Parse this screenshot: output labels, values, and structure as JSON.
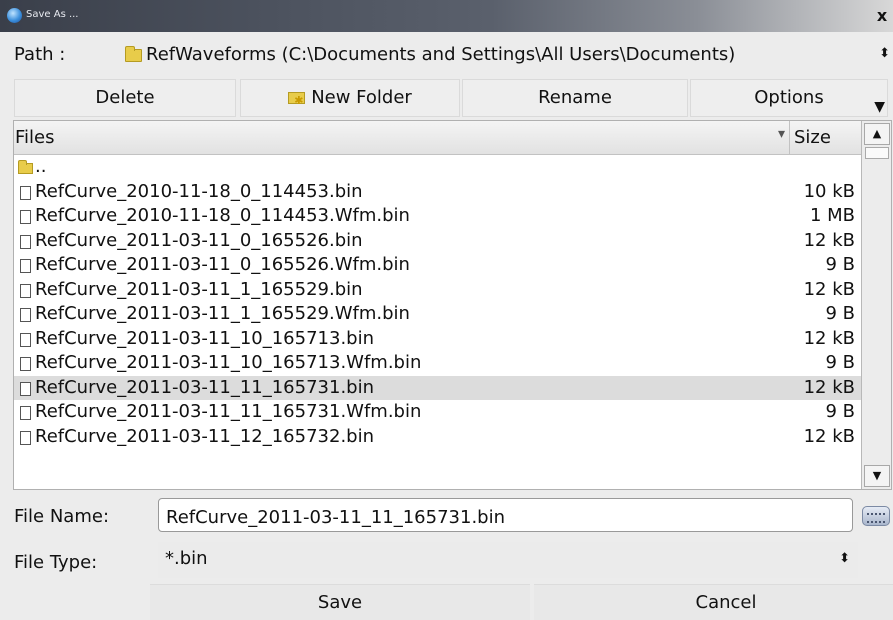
{
  "window": {
    "title": "Save As ...",
    "close_glyph": "x"
  },
  "path": {
    "label": "Path :",
    "folder_icon": "folder-icon",
    "value": "RefWaveforms   (C:\\Documents and Settings\\All Users\\Documents)",
    "arrow": "⬍"
  },
  "toolbar": {
    "delete_label": "Delete",
    "new_folder_icon": "new-folder-icon",
    "new_folder_label": "New Folder",
    "rename_label": "Rename",
    "options_label": "Options",
    "options_arrow": "▼"
  },
  "files": {
    "header_files": "Files",
    "header_size": "Size",
    "sort_glyph": "▾",
    "items": [
      {
        "type": "folder",
        "name": "..",
        "size": ""
      },
      {
        "type": "file",
        "name": "RefCurve_2010-11-18_0_114453.bin",
        "size": "10 kB"
      },
      {
        "type": "file",
        "name": "RefCurve_2010-11-18_0_114453.Wfm.bin",
        "size": "1 MB"
      },
      {
        "type": "file",
        "name": "RefCurve_2011-03-11_0_165526.bin",
        "size": "12 kB"
      },
      {
        "type": "file",
        "name": "RefCurve_2011-03-11_0_165526.Wfm.bin",
        "size": "9 B"
      },
      {
        "type": "file",
        "name": "RefCurve_2011-03-11_1_165529.bin",
        "size": "12 kB"
      },
      {
        "type": "file",
        "name": "RefCurve_2011-03-11_1_165529.Wfm.bin",
        "size": "9 B"
      },
      {
        "type": "file",
        "name": "RefCurve_2011-03-11_10_165713.bin",
        "size": "12 kB"
      },
      {
        "type": "file",
        "name": "RefCurve_2011-03-11_10_165713.Wfm.bin",
        "size": "9 B"
      },
      {
        "type": "file",
        "name": "RefCurve_2011-03-11_11_165731.bin",
        "size": "12 kB",
        "selected": true
      },
      {
        "type": "file",
        "name": "RefCurve_2011-03-11_11_165731.Wfm.bin",
        "size": "9 B"
      },
      {
        "type": "file",
        "name": "RefCurve_2011-03-11_12_165732.bin",
        "size": "12 kB"
      }
    ]
  },
  "scrollbar": {
    "up": "▲",
    "down": "▼"
  },
  "file_name": {
    "label": "File Name:",
    "value": "RefCurve_2011-03-11_11_165731.bin"
  },
  "file_type": {
    "label": "File Type:",
    "value": "*.bin",
    "arrow": "⬍"
  },
  "buttons": {
    "save": "Save",
    "cancel": "Cancel"
  }
}
